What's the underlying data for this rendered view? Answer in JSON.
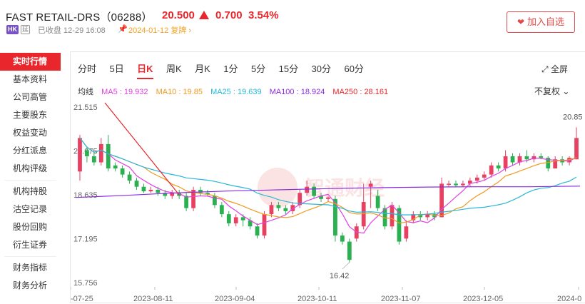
{
  "header": {
    "stock_name": "FAST RETAIL-DRS（06288）",
    "price": "20.500",
    "change": "0.700",
    "change_pct": "3.54%",
    "market_badge": "HK",
    "delay_badge": "延",
    "status_text": "已收盘 12-29 16:08",
    "notice_text": "2024-01-12 复牌 ›",
    "watch_label": "加入自选",
    "up_color": "#e8262b"
  },
  "sidebar": {
    "items": [
      "实时行情",
      "基本资料",
      "公司高管",
      "主要股东",
      "权益变动",
      "分红派息",
      "机构评级",
      "机构持股",
      "沽空记录",
      "股份回购",
      "衍生证券",
      "财务指标",
      "财务分析"
    ]
  },
  "tabs": [
    "分时",
    "5日",
    "日K",
    "周K",
    "月K",
    "1分",
    "5分",
    "15分",
    "30分",
    "60分"
  ],
  "active_tab": "日K",
  "toolbar": {
    "fullscreen_label": "全屏",
    "adjust_label": "不复权"
  },
  "ma_legend": {
    "title": "均线",
    "items": [
      {
        "label": "MA5 : 19.932",
        "color": "#e040e0"
      },
      {
        "label": "MA10 : 19.85",
        "color": "#f09a20"
      },
      {
        "label": "MA25 : 19.639",
        "color": "#28b8d8"
      },
      {
        "label": "MA100 : 18.924",
        "color": "#8a2be2"
      },
      {
        "label": "MA250 : 28.161",
        "color": "#e8262b"
      }
    ]
  },
  "chart_data": {
    "type": "candlestick",
    "y_ticks": [
      "21.515",
      "20.075",
      "18.635",
      "17.195",
      "15.756"
    ],
    "y_tick_values": [
      21.515,
      20.075,
      18.635,
      17.195,
      15.756
    ],
    "ylim": [
      15.756,
      21.515
    ],
    "x_labels": [
      "-07-25",
      "2023-08-11",
      "2023-09-04",
      "2023-10-11",
      "2023-11-07",
      "2023-12-05",
      "2024-0"
    ],
    "annotations": {
      "high": "20.85",
      "low": "16.42"
    },
    "up_color": "#e84060",
    "down_color": "#2ab050",
    "candles": [
      [
        19.4,
        20.5,
        20.6,
        19.1
      ],
      [
        20.1,
        19.9,
        20.2,
        19.7
      ],
      [
        19.9,
        19.7,
        20.0,
        19.6
      ],
      [
        19.7,
        20.3,
        20.5,
        19.6
      ],
      [
        20.3,
        19.5,
        20.6,
        19.4
      ],
      [
        19.6,
        19.5,
        19.7,
        19.4
      ],
      [
        19.5,
        19.3,
        19.6,
        19.2
      ],
      [
        19.3,
        19.1,
        19.4,
        19.0
      ],
      [
        19.1,
        18.9,
        19.2,
        18.8
      ],
      [
        18.9,
        18.75,
        19.0,
        18.7
      ],
      [
        18.75,
        18.8,
        18.9,
        18.7
      ],
      [
        18.8,
        18.7,
        18.9,
        18.6
      ],
      [
        18.7,
        18.6,
        18.8,
        18.5
      ],
      [
        18.6,
        18.7,
        18.8,
        18.5
      ],
      [
        18.7,
        18.6,
        18.8,
        18.5
      ],
      [
        18.6,
        18.2,
        18.7,
        18.1
      ],
      [
        18.2,
        18.8,
        18.9,
        18.1
      ],
      [
        18.8,
        18.7,
        18.9,
        18.6
      ],
      [
        18.7,
        18.65,
        18.8,
        18.6
      ],
      [
        18.6,
        18.3,
        18.7,
        18.2
      ],
      [
        18.3,
        18.0,
        18.4,
        17.9
      ],
      [
        18.0,
        17.7,
        18.1,
        17.6
      ],
      [
        17.7,
        17.9,
        18.0,
        17.6
      ],
      [
        17.9,
        17.8,
        18.0,
        17.6
      ],
      [
        17.8,
        17.6,
        17.9,
        17.5
      ],
      [
        17.6,
        17.3,
        17.7,
        17.2
      ],
      [
        17.3,
        18.0,
        18.1,
        17.2
      ],
      [
        18.0,
        18.3,
        18.4,
        17.9
      ],
      [
        18.3,
        18.2,
        18.4,
        18.1
      ],
      [
        18.2,
        18.1,
        18.3,
        18.0
      ],
      [
        18.1,
        18.3,
        18.4,
        18.0
      ],
      [
        18.3,
        18.7,
        18.8,
        18.2
      ],
      [
        18.7,
        18.9,
        19.1,
        18.6
      ],
      [
        18.9,
        18.6,
        19.0,
        18.5
      ],
      [
        18.6,
        18.5,
        18.7,
        18.4
      ],
      [
        18.5,
        18.55,
        18.6,
        18.4
      ],
      [
        18.5,
        17.3,
        18.6,
        17.1
      ],
      [
        17.3,
        17.1,
        17.4,
        17.0
      ],
      [
        17.1,
        16.5,
        17.2,
        16.42
      ],
      [
        17.2,
        17.6,
        17.7,
        17.1
      ],
      [
        17.6,
        18.4,
        19.0,
        17.5
      ],
      [
        18.9,
        19.0,
        19.1,
        18.2
      ],
      [
        18.6,
        18.2,
        18.8,
        18.1
      ],
      [
        18.2,
        17.6,
        18.3,
        17.5
      ],
      [
        17.6,
        18.3,
        18.4,
        17.5
      ],
      [
        18.2,
        17.1,
        18.3,
        17.0
      ],
      [
        17.2,
        17.6,
        17.8,
        17.1
      ],
      [
        17.8,
        18.0,
        18.1,
        17.7
      ],
      [
        18.0,
        17.9,
        18.1,
        17.8
      ],
      [
        17.9,
        18.0,
        18.1,
        17.8
      ],
      [
        18.0,
        17.9,
        18.1,
        17.8
      ],
      [
        17.9,
        19.0,
        19.2,
        17.9
      ],
      [
        19.0,
        19.0,
        19.1,
        18.9
      ],
      [
        19.0,
        18.95,
        19.1,
        18.9
      ],
      [
        18.95,
        19.0,
        19.1,
        18.9
      ],
      [
        19.0,
        19.1,
        19.2,
        18.9
      ],
      [
        19.1,
        19.2,
        19.3,
        19.0
      ],
      [
        19.2,
        19.3,
        19.4,
        19.1
      ],
      [
        19.3,
        19.6,
        19.7,
        19.2
      ],
      [
        19.6,
        19.5,
        19.7,
        19.4
      ],
      [
        19.5,
        19.9,
        20.1,
        19.4
      ],
      [
        19.9,
        19.7,
        20.0,
        19.6
      ],
      [
        19.7,
        19.9,
        20.0,
        19.6
      ],
      [
        19.9,
        19.8,
        20.1,
        19.7
      ],
      [
        19.8,
        19.9,
        20.0,
        19.7
      ],
      [
        19.9,
        19.85,
        20.0,
        19.8
      ],
      [
        19.85,
        19.5,
        19.9,
        19.4
      ],
      [
        19.5,
        19.8,
        19.9,
        19.5
      ],
      [
        19.8,
        19.7,
        19.9,
        19.6
      ],
      [
        19.7,
        19.85,
        19.9,
        19.6
      ],
      [
        19.8,
        20.5,
        20.85,
        19.8
      ]
    ],
    "series": [
      {
        "name": "MA5",
        "color": "#e040e0"
      },
      {
        "name": "MA10",
        "color": "#f09a20"
      },
      {
        "name": "MA25",
        "color": "#28b8d8"
      },
      {
        "name": "MA100",
        "color": "#8a2be2",
        "values": [
          18.55,
          18.62,
          18.7,
          18.76,
          18.8,
          18.84,
          18.87,
          18.89,
          18.9,
          18.9,
          18.92
        ]
      },
      {
        "name": "MA250",
        "color": "#e8262b",
        "values": [
          21.6,
          18.635
        ]
      }
    ]
  }
}
